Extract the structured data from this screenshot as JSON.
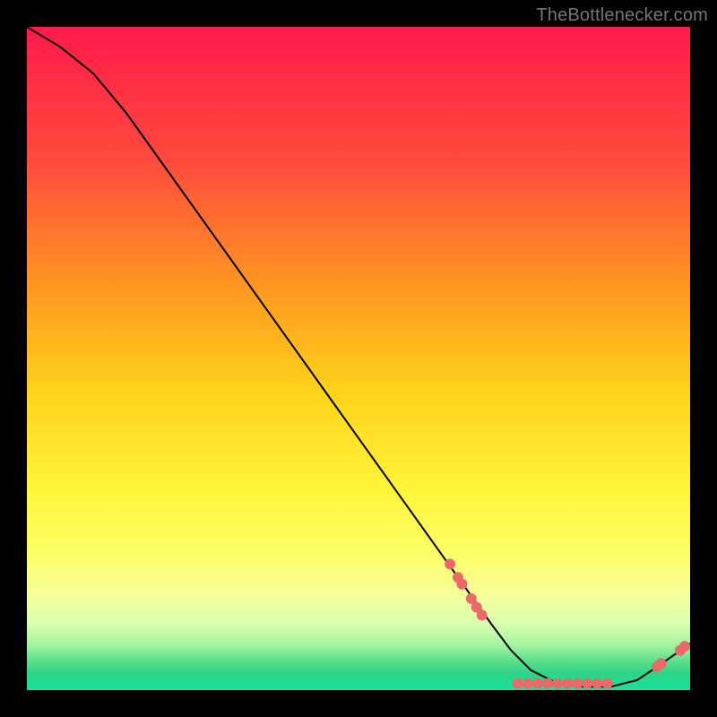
{
  "watermark": "TheBottlenecker.com",
  "chart_data": {
    "type": "line",
    "title": "",
    "xlabel": "",
    "ylabel": "",
    "xlim": [
      0,
      100
    ],
    "ylim": [
      0,
      100
    ],
    "series": [
      {
        "name": "curve",
        "color": "#000000",
        "x": [
          0,
          5,
          10,
          15,
          20,
          25,
          30,
          35,
          40,
          45,
          50,
          55,
          60,
          65,
          70,
          73,
          76,
          80,
          84,
          88,
          92,
          95,
          100
        ],
        "y": [
          100,
          97,
          93,
          87,
          80,
          73,
          66,
          59,
          52,
          45,
          38,
          31,
          24,
          17,
          10,
          6,
          3,
          1,
          0.5,
          0.5,
          1.5,
          3.5,
          7
        ]
      }
    ],
    "scatter": [
      {
        "name": "dots",
        "color": "#ea6a6a",
        "points": [
          {
            "x": 63.8,
            "y": 19
          },
          {
            "x": 65.0,
            "y": 17
          },
          {
            "x": 65.6,
            "y": 16
          },
          {
            "x": 67.0,
            "y": 13.8
          },
          {
            "x": 67.8,
            "y": 12.5
          },
          {
            "x": 68.6,
            "y": 11.3
          },
          {
            "x": 74.0,
            "y": 1.0
          },
          {
            "x": 75.5,
            "y": 1.0
          },
          {
            "x": 77.0,
            "y": 1.0
          },
          {
            "x": 78.5,
            "y": 1.0
          },
          {
            "x": 80.0,
            "y": 1.0
          },
          {
            "x": 81.5,
            "y": 1.0
          },
          {
            "x": 83.0,
            "y": 1.0
          },
          {
            "x": 84.5,
            "y": 1.0
          },
          {
            "x": 86.0,
            "y": 1.0
          },
          {
            "x": 87.5,
            "y": 1.0
          },
          {
            "x": 95.0,
            "y": 3.5
          },
          {
            "x": 95.6,
            "y": 4.0
          },
          {
            "x": 98.5,
            "y": 6.0
          },
          {
            "x": 99.2,
            "y": 6.6
          }
        ]
      }
    ],
    "background_gradient": {
      "stops": [
        {
          "offset": 0.0,
          "color": "#ff1a4b"
        },
        {
          "offset": 0.2,
          "color": "#ff4a3d"
        },
        {
          "offset": 0.4,
          "color": "#ff9a20"
        },
        {
          "offset": 0.55,
          "color": "#ffd21a"
        },
        {
          "offset": 0.7,
          "color": "#fff53a"
        },
        {
          "offset": 0.8,
          "color": "#fcff6a"
        },
        {
          "offset": 0.86,
          "color": "#f4ff9e"
        },
        {
          "offset": 0.9,
          "color": "#d8ffb0"
        },
        {
          "offset": 0.93,
          "color": "#a8f5a0"
        },
        {
          "offset": 0.955,
          "color": "#5ee08d"
        },
        {
          "offset": 0.975,
          "color": "#2dd486"
        },
        {
          "offset": 1.0,
          "color": "#17e29c"
        }
      ]
    }
  }
}
